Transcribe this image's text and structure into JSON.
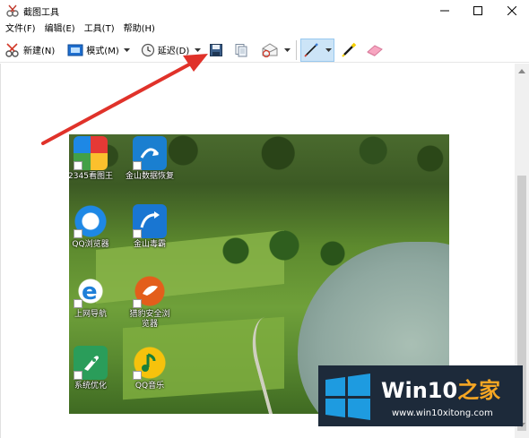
{
  "window": {
    "title": "截图工具",
    "controls": {
      "minimize": "minimize",
      "maximize": "maximize",
      "close": "close"
    }
  },
  "menu": [
    "文件(F)",
    "编辑(E)",
    "工具(T)",
    "帮助(H)"
  ],
  "toolbar": {
    "new_label": "新建(N)",
    "mode_label": "模式(M)",
    "delay_label": "延迟(D)",
    "icons": [
      "scissors-icon",
      "mode-icon",
      "clock-icon",
      "save-icon",
      "copy-icon",
      "send-icon",
      "pen-icon",
      "highlighter-icon",
      "eraser-icon"
    ]
  },
  "desktop_icons": [
    {
      "label": "2345看图王",
      "color": "#f0b020"
    },
    {
      "label": "金山数据恢复",
      "color": "#1a7fd0"
    },
    {
      "label": "QQ浏览器",
      "color": "#1e88e5"
    },
    {
      "label": "金山毒霸",
      "color": "#1976d2"
    },
    {
      "label": "上网导航",
      "color": "#1e7fd8"
    },
    {
      "label": "猎豹安全浏览器",
      "color": "#e35e1b"
    },
    {
      "label": "系统优化",
      "color": "#2a9d5a"
    },
    {
      "label": "QQ音乐",
      "color": "#f6c20c"
    }
  ],
  "watermark": {
    "title_main": "Win10",
    "title_accent": "之家",
    "url": "www.win10xitong.com"
  },
  "colors": {
    "arrow": "#e0322a",
    "active_tool_bg": "#cce4f7"
  }
}
